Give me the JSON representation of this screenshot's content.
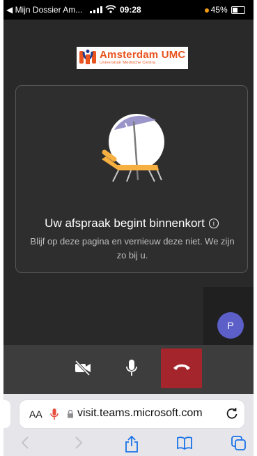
{
  "status_bar": {
    "back_app": "◀ Mijn Dossier Am...",
    "time": "09:28",
    "battery": "45%"
  },
  "logo": {
    "name": "Amsterdam UMC",
    "subtitle": "Universitair Medische Centra"
  },
  "lobby": {
    "title": "Uw afspraak begint binnenkort",
    "info_icon": "i",
    "message": "Blijf op deze pagina en vernieuw deze niet. We zijn zo bij u."
  },
  "self_view": {
    "avatar_initial": "P",
    "avatar_color": "#5b5fc7"
  },
  "controls": {
    "camera": "camera-off-icon",
    "mic": "microphone-icon",
    "hangup": "hang-up-icon",
    "hangup_color": "#a4262c"
  },
  "browser": {
    "text_size_label": "AA",
    "url": "visit.teams.microsoft.com"
  }
}
